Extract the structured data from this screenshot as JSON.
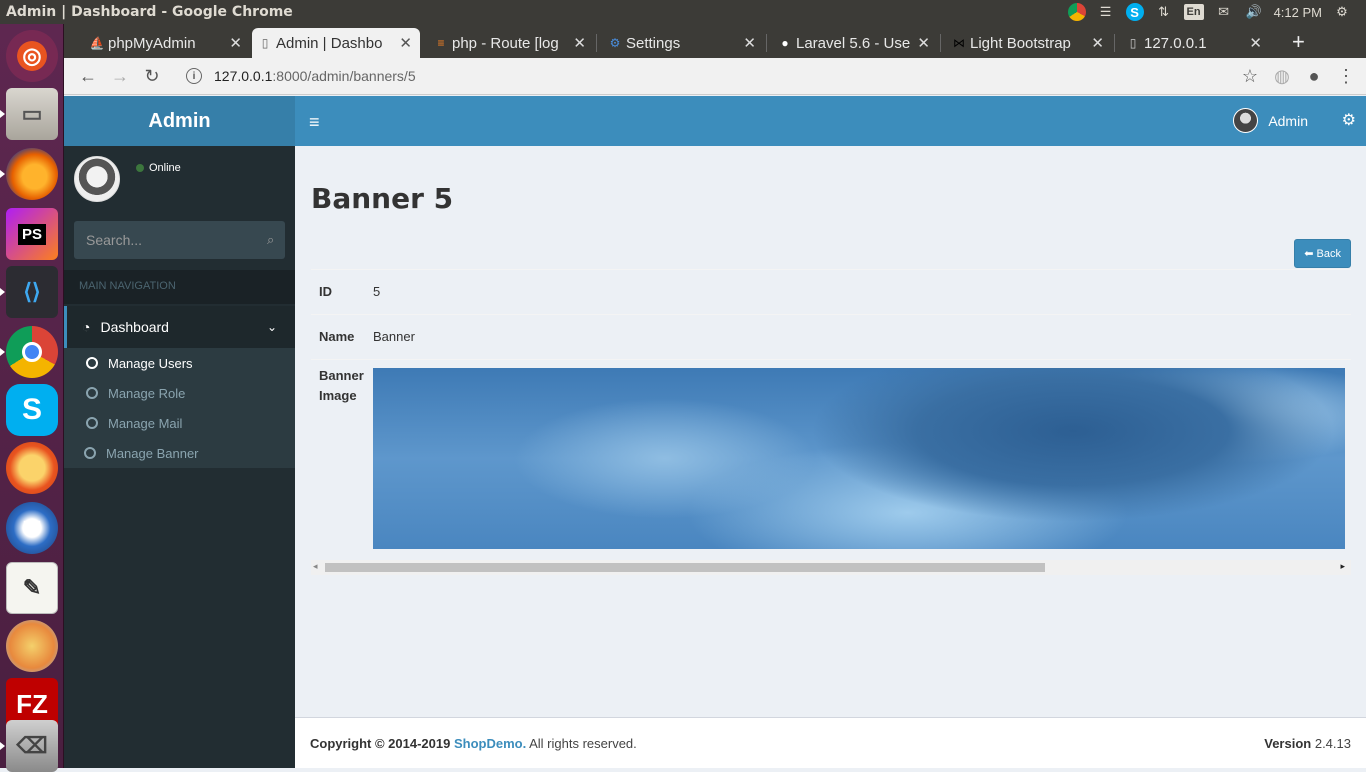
{
  "os": {
    "window_title": "Admin | Dashboard - Google Chrome",
    "clock": "4:12 PM",
    "keyboard": "En"
  },
  "browser": {
    "tabs": [
      {
        "label": "phpMyAdmin"
      },
      {
        "label": "Admin | Dashbo"
      },
      {
        "label": "php - Route [log"
      },
      {
        "label": "Settings"
      },
      {
        "label": "Laravel 5.6 - Use"
      },
      {
        "label": "Light Bootstrap"
      },
      {
        "label": "127.0.0.1"
      }
    ],
    "url_host": "127.0.0.1",
    "url_rest": ":8000/admin/banners/5"
  },
  "app": {
    "logo": "Admin",
    "nav_user": "Admin",
    "sidebar": {
      "status": "Online",
      "search_placeholder": "Search...",
      "header": "MAIN NAVIGATION",
      "dashboard_label": "Dashboard",
      "items": [
        {
          "label": "Manage Users"
        },
        {
          "label": "Manage Role"
        },
        {
          "label": "Manage Mail"
        },
        {
          "label": "Manage Banner"
        }
      ]
    },
    "page_title": "Banner 5",
    "back_label": "Back",
    "fields": {
      "id_label": "ID",
      "id_value": "5",
      "name_label": "Name",
      "name_value": "Banner",
      "image_label": "Banner Image"
    },
    "footer": {
      "copyright_prefix": "Copyright © 2014-2019",
      "brand": "ShopDemo.",
      "suffix": "All rights reserved.",
      "version_label": "Version",
      "version_value": "2.4.13"
    }
  }
}
